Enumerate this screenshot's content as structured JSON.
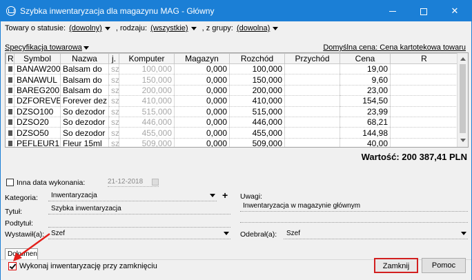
{
  "window": {
    "title": "Szybka inwentaryzacja dla magazynu MAG - Główny",
    "controls": {
      "minimize": "—",
      "maximize": "□",
      "close": "✕"
    }
  },
  "filters": {
    "status_label": "Towary o statusie:",
    "status_value": "(dowolny)",
    "kind_label": ", rodzaju:",
    "kind_value": "(wszystkie)",
    "group_label": ", z grupy:",
    "group_value": "(dowolna)"
  },
  "spec_label": "Specyfikacja towarowa",
  "default_price": "Domyślna cena: Cena kartotekowa towaru",
  "table": {
    "columns": [
      "R",
      "Symbol",
      "Nazwa",
      "j.",
      "Komputer",
      "Magazyn",
      "Rozchód",
      "Przychód",
      "Cena",
      "R"
    ],
    "rows": [
      {
        "symbol": "BANAW200",
        "nazwa": "Balsam do",
        "j": "sz",
        "komputer": "100,000",
        "magazyn": "0,000",
        "rozchod": "100,000",
        "przychod": "",
        "cena": "19,00"
      },
      {
        "symbol": "BANAWUL",
        "nazwa": "Balsam do",
        "j": "sz",
        "komputer": "150,000",
        "magazyn": "0,000",
        "rozchod": "150,000",
        "przychod": "",
        "cena": "9,60"
      },
      {
        "symbol": "BAREG200",
        "nazwa": "Balsam do",
        "j": "sz",
        "komputer": "200,000",
        "magazyn": "0,000",
        "rozchod": "200,000",
        "przychod": "",
        "cena": "23,00"
      },
      {
        "symbol": "DZFOREVE",
        "nazwa": "Forever dez",
        "j": "sz",
        "komputer": "410,000",
        "magazyn": "0,000",
        "rozchod": "410,000",
        "przychod": "",
        "cena": "154,50"
      },
      {
        "symbol": "DZSO100",
        "nazwa": "So dezodor",
        "j": "sz",
        "komputer": "515,000",
        "magazyn": "0,000",
        "rozchod": "515,000",
        "przychod": "",
        "cena": "23,99"
      },
      {
        "symbol": "DZSO20",
        "nazwa": "So dezodor",
        "j": "sz",
        "komputer": "446,000",
        "magazyn": "0,000",
        "rozchod": "446,000",
        "przychod": "",
        "cena": "68,21"
      },
      {
        "symbol": "DZSO50",
        "nazwa": "So dezodor",
        "j": "sz",
        "komputer": "455,000",
        "magazyn": "0,000",
        "rozchod": "455,000",
        "przychod": "",
        "cena": "144,98"
      },
      {
        "symbol": "PEFLEUR1",
        "nazwa": "Fleur 15ml",
        "j": "sz",
        "komputer": "509,000",
        "magazyn": "0,000",
        "rozchod": "509,000",
        "przychod": "",
        "cena": "40,00"
      }
    ],
    "current_row_index": 5
  },
  "total": "Wartość: 200 387,41 PLN",
  "form": {
    "other_date_label": "Inna data wykonania:",
    "other_date_value": "21-12-2018",
    "kategoria_label": "Kategoria:",
    "kategoria_value": "Inwentaryzacja",
    "tytul_label": "Tytuł:",
    "tytul_value": "Szybka inwentaryzacja",
    "podtytul_label": "Podtytuł:",
    "podtytul_value": "",
    "wystawil_label": "Wystawił(a):",
    "wystawil_value": "Szef",
    "uwagi_label": "Uwagi:",
    "uwagi_value": "Inwentaryzacja w magazynie głównym",
    "odebral_label": "Odebrał(a):",
    "odebral_value": "Szef",
    "plus": "+"
  },
  "tab_label": "Dokument",
  "execute_on_close_label": "Wykonaj inwentaryzację przy zamknięciu",
  "execute_on_close_checked": true,
  "buttons": {
    "close": "Zamknij",
    "help": "Pomoc"
  },
  "colors": {
    "titlebar": "#1b7fd6",
    "highlight": "#d21f1f"
  }
}
